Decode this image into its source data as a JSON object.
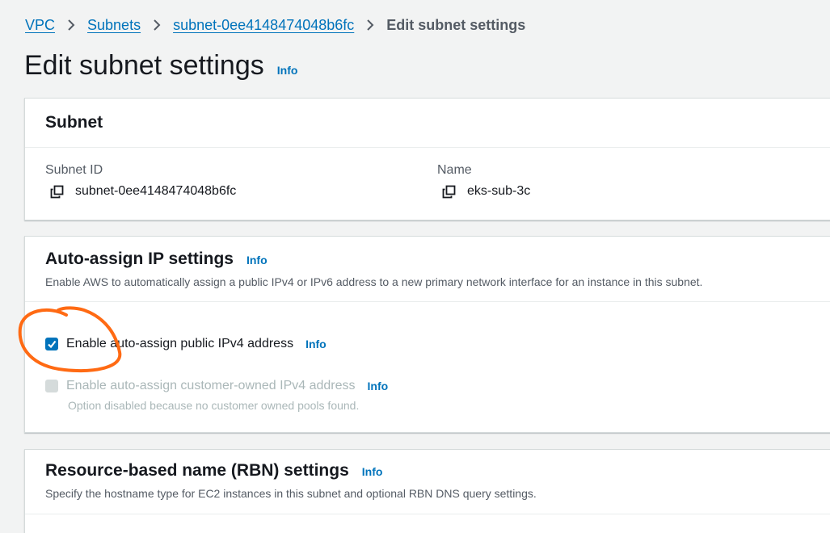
{
  "breadcrumb": {
    "items": [
      {
        "label": "VPC"
      },
      {
        "label": "Subnets"
      },
      {
        "label": "subnet-0ee4148474048b6fc"
      }
    ],
    "current": "Edit subnet settings"
  },
  "page": {
    "title": "Edit subnet settings",
    "info_label": "Info"
  },
  "subnet_panel": {
    "title": "Subnet",
    "subnet_id_label": "Subnet ID",
    "subnet_id_value": "subnet-0ee4148474048b6fc",
    "name_label": "Name",
    "name_value": "eks-sub-3c",
    "copy_icon": "copy-icon"
  },
  "auto_assign_panel": {
    "title": "Auto-assign IP settings",
    "info_label": "Info",
    "description": "Enable AWS to automatically assign a public IPv4 or IPv6 address to a new primary network interface for an instance in this subnet.",
    "options": [
      {
        "label": "Enable auto-assign public IPv4 address",
        "checked": true,
        "disabled": false,
        "info_label": "Info"
      },
      {
        "label": "Enable auto-assign customer-owned IPv4 address",
        "checked": false,
        "disabled": true,
        "info_label": "Info"
      }
    ],
    "disabled_hint": "Option disabled because no customer owned pools found."
  },
  "rbn_panel": {
    "title": "Resource-based name (RBN) settings",
    "info_label": "Info",
    "description": "Specify the hostname type for EC2 instances in this subnet and optional RBN DNS query settings."
  },
  "colors": {
    "link": "#0073bb",
    "background": "#f2f3f3",
    "annotation": "#ff6a13"
  }
}
